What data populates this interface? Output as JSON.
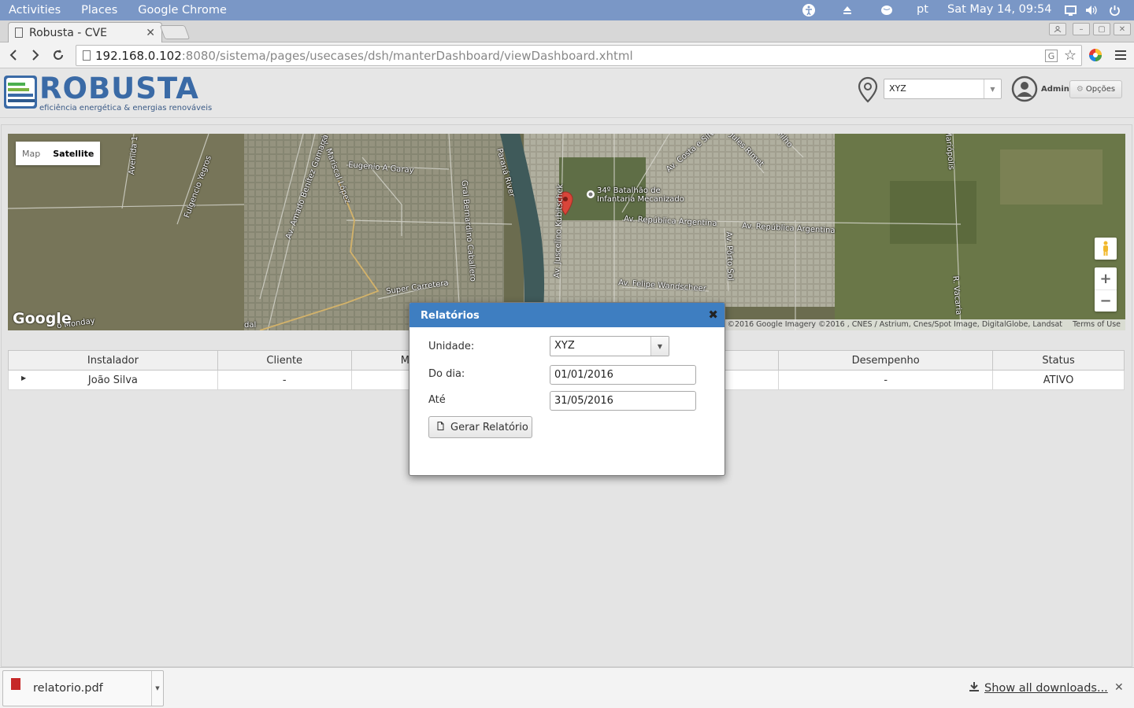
{
  "gnome": {
    "activities": "Activities",
    "places": "Places",
    "app": "Google Chrome",
    "lang": "pt",
    "clock": "Sat May 14, 09:54"
  },
  "browser": {
    "tab_title": "Robusta - CVE",
    "url_host": "192.168.0.102",
    "url_rest": ":8080/sistema/pages/usecases/dsh/manterDashboard/viewDashboard.xhtml"
  },
  "header": {
    "logo_word": "ROBUSTA",
    "logo_tagline": "eficiência energética & energias renováveis",
    "unit_select": "XYZ",
    "user": "Admin",
    "options_label": "Opções"
  },
  "map": {
    "type_map": "Map",
    "type_satellite": "Satellite",
    "google_logo": "Google",
    "attribution": "ap data ©2016 Google Imagery ©2016 , CNES / Astrium, Cnes/Spot Image, DigitalGlobe, Landsat",
    "terms": "Terms of Use",
    "labels": [
      "34º Batalhão de",
      "Infantaria Mecanizado",
      "Av. República Argentina",
      "Av. República Argentina",
      "Eugenio A Garay",
      "Av. Mariscal López",
      "Av. Amado Benítez Gamarra",
      "Fulgencio Yegros",
      "Gral Bernardino Caballero",
      "Paraná River",
      "Super Carretera",
      "Av. Felipe Wandscheer",
      "Av. Juscelino Kubitschek",
      "Av. Costa e Silva",
      "Jules Rimet",
      "Av. Pôrto Sol",
      "R. Vacaria",
      "Mariópolis",
      "Avenida 1",
      "o Monday",
      "Filho",
      "dal"
    ]
  },
  "table": {
    "headers": [
      "Instalador",
      "Cliente",
      "M",
      "",
      "Desempenho",
      "Status"
    ],
    "row": {
      "installer": "João Silva",
      "client": "-",
      "performance": "-",
      "status": "ATIVO"
    }
  },
  "dialog": {
    "title": "Relatórios",
    "unit_label": "Unidade:",
    "unit_value": "XYZ",
    "from_label": "Do dia:",
    "from_value": "01/01/2016",
    "to_label": "Até",
    "to_value": "31/05/2016",
    "button": "Gerar Relatório"
  },
  "downloads": {
    "file": "relatorio.pdf",
    "show_all": "Show all downloads..."
  }
}
